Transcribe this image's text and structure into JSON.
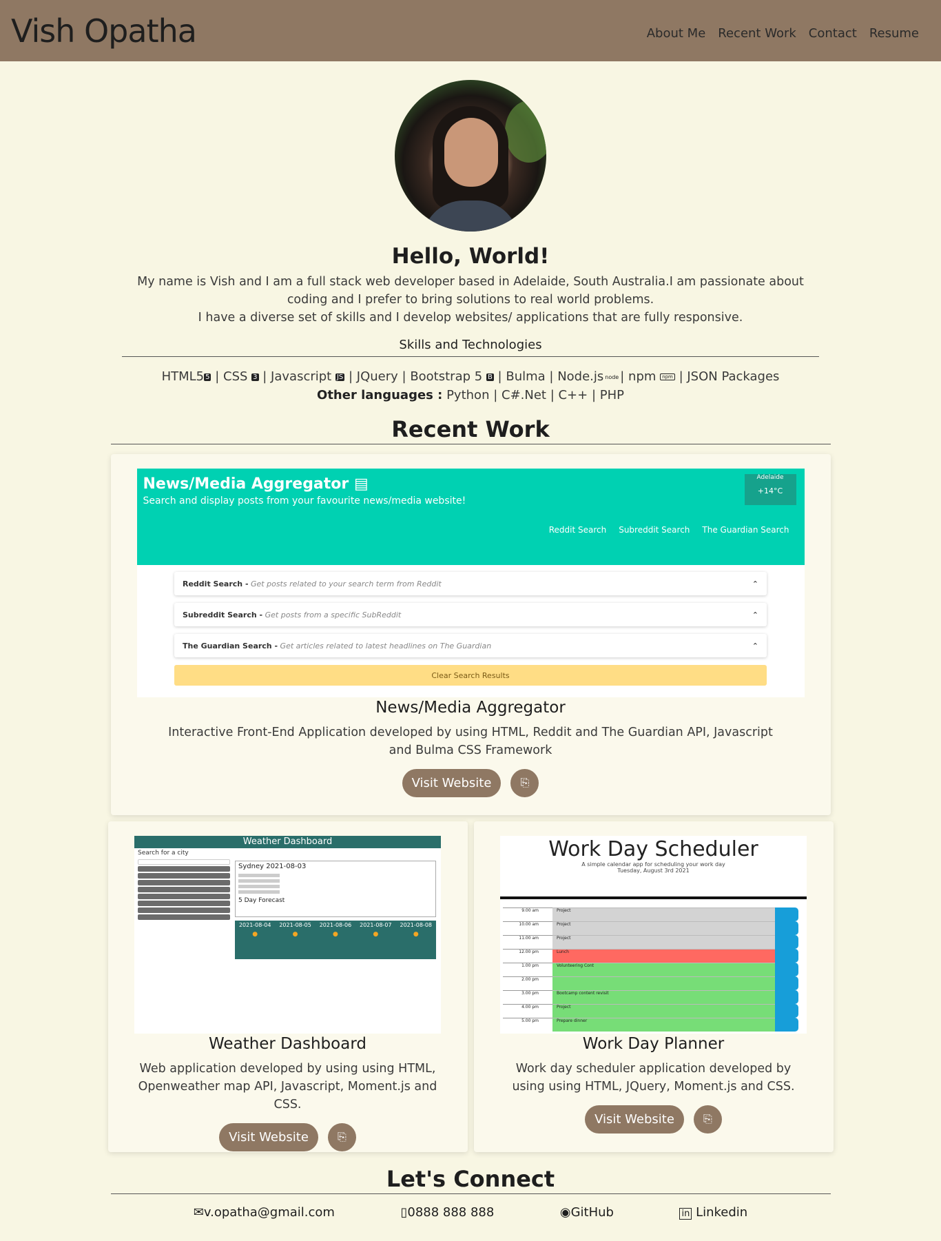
{
  "nav": {
    "brand": "Vish Opatha",
    "links": [
      "About Me",
      "Recent Work",
      "Contact",
      "Resume"
    ]
  },
  "hero": {
    "greeting": "Hello, World!",
    "intro_line1": "My name is Vish and I am a full stack web developer based in Adelaide, South Australia.I am passionate about coding and I prefer to bring solutions to real world problems.",
    "intro_line2": "I have a diverse set of skills and I develop websites/ applications that are fully responsive.",
    "skills_title": "Skills and Technologies",
    "skills": [
      "HTML5",
      "CSS",
      "Javascript",
      "JQuery",
      "Bootstrap 5",
      "Bulma",
      "Node.js",
      "npm",
      "JSON Packages"
    ],
    "other_label": "Other languages :",
    "other_languages": [
      "Python",
      "C#.Net",
      "C++",
      "PHP"
    ]
  },
  "recent_work": {
    "title": "Recent Work",
    "projects": [
      {
        "name": "News/Media Aggregator",
        "description": "Interactive Front-End Application developed by using HTML, Reddit and The Guardian API, Javascript and Bulma CSS Framework",
        "button": "Visit Website",
        "preview": {
          "title": "News/Media Aggregator",
          "subtitle": "Search and display posts from your favourite news/media website!",
          "weather_city": "Adelaide",
          "weather_temp": "+14°C",
          "links": [
            "Reddit Search",
            "Subreddit Search",
            "The Guardian Search"
          ],
          "accordion": [
            {
              "title": "Reddit Search -",
              "hint": "Get posts related to your search term from Reddit"
            },
            {
              "title": "Subreddit Search -",
              "hint": "Get posts from a specific SubReddit"
            },
            {
              "title": "The Guardian Search -",
              "hint": "Get articles related to latest headlines on The Guardian"
            }
          ],
          "clear_button": "Clear Search Results"
        }
      },
      {
        "name": "Weather Dashboard",
        "description": "Web application developed by using using HTML, Openweather map API, Javascript, Moment.js and CSS.",
        "button": "Visit Website",
        "preview": {
          "header": "Weather Dashboard",
          "search_label": "Search for a city",
          "city_line": "Sydney 2021-08-03",
          "forecast_label": "5 Day Forecast",
          "dates": [
            "2021-08-04",
            "2021-08-05",
            "2021-08-06",
            "2021-08-07",
            "2021-08-08"
          ]
        }
      },
      {
        "name": "Work Day Planner",
        "description": "Work day scheduler application developed by using using HTML, JQuery, Moment.js and CSS.",
        "button": "Visit Website",
        "preview": {
          "title": "Work Day Scheduler",
          "subtitle": "A simple calendar app for scheduling your work day",
          "date": "Tuesday, August 3rd 2021",
          "rows": [
            {
              "hour": "9.00 am",
              "event": "Project",
              "status": "past"
            },
            {
              "hour": "10.00 am",
              "event": "Project",
              "status": "past"
            },
            {
              "hour": "11.00 am",
              "event": "Project",
              "status": "past"
            },
            {
              "hour": "12.00 pm",
              "event": "Lunch",
              "status": "present"
            },
            {
              "hour": "1.00 pm",
              "event": "Volunteering Cont",
              "status": "future"
            },
            {
              "hour": "2.00 pm",
              "event": "",
              "status": "future"
            },
            {
              "hour": "3.00 pm",
              "event": "Bootcamp content revisit",
              "status": "future"
            },
            {
              "hour": "4.00 pm",
              "event": "Project",
              "status": "future"
            },
            {
              "hour": "5.00 pm",
              "event": "Prepare dinner",
              "status": "future"
            }
          ]
        }
      }
    ]
  },
  "connect": {
    "title": "Let's Connect",
    "email": "v.opatha@gmail.com",
    "phone": "0888 888 888",
    "github": "GitHub",
    "linkedin": "Linkedin"
  },
  "colors": {
    "nav_bg": "#8f7863",
    "page_bg": "#f8f6e3",
    "button_bg": "#8f7863",
    "news_teal": "#00d1b2",
    "past": "#d3d3d3",
    "present": "#ff6961",
    "future": "#77dd77"
  },
  "icons": [
    "html5-icon",
    "css3-icon",
    "js-icon",
    "bootstrap-icon",
    "node-icon",
    "npm-icon",
    "code-file-icon",
    "envelope-icon",
    "phone-icon",
    "github-icon",
    "linkedin-icon"
  ]
}
